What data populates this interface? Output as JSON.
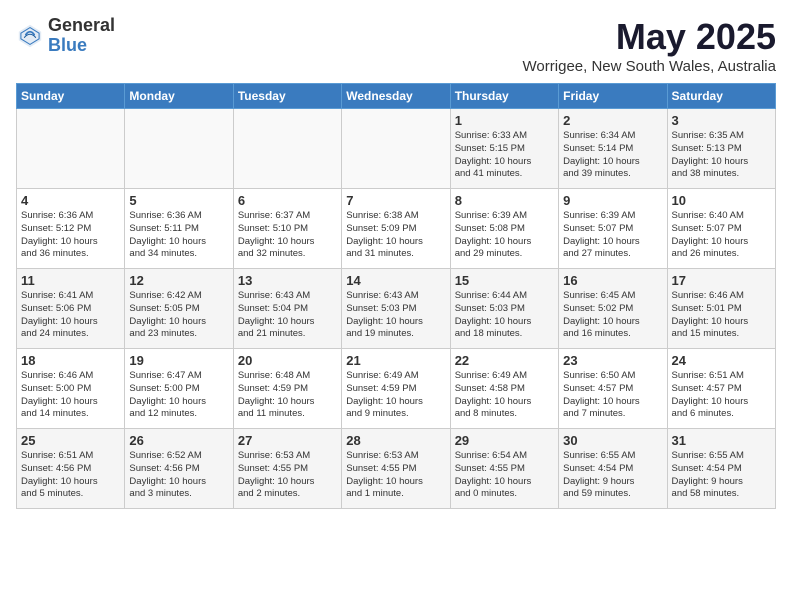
{
  "logo": {
    "general": "General",
    "blue": "Blue"
  },
  "header": {
    "month": "May 2025",
    "location": "Worrigee, New South Wales, Australia"
  },
  "weekdays": [
    "Sunday",
    "Monday",
    "Tuesday",
    "Wednesday",
    "Thursday",
    "Friday",
    "Saturday"
  ],
  "weeks": [
    [
      {
        "day": "",
        "content": ""
      },
      {
        "day": "",
        "content": ""
      },
      {
        "day": "",
        "content": ""
      },
      {
        "day": "",
        "content": ""
      },
      {
        "day": "1",
        "content": "Sunrise: 6:33 AM\nSunset: 5:15 PM\nDaylight: 10 hours\nand 41 minutes."
      },
      {
        "day": "2",
        "content": "Sunrise: 6:34 AM\nSunset: 5:14 PM\nDaylight: 10 hours\nand 39 minutes."
      },
      {
        "day": "3",
        "content": "Sunrise: 6:35 AM\nSunset: 5:13 PM\nDaylight: 10 hours\nand 38 minutes."
      }
    ],
    [
      {
        "day": "4",
        "content": "Sunrise: 6:36 AM\nSunset: 5:12 PM\nDaylight: 10 hours\nand 36 minutes."
      },
      {
        "day": "5",
        "content": "Sunrise: 6:36 AM\nSunset: 5:11 PM\nDaylight: 10 hours\nand 34 minutes."
      },
      {
        "day": "6",
        "content": "Sunrise: 6:37 AM\nSunset: 5:10 PM\nDaylight: 10 hours\nand 32 minutes."
      },
      {
        "day": "7",
        "content": "Sunrise: 6:38 AM\nSunset: 5:09 PM\nDaylight: 10 hours\nand 31 minutes."
      },
      {
        "day": "8",
        "content": "Sunrise: 6:39 AM\nSunset: 5:08 PM\nDaylight: 10 hours\nand 29 minutes."
      },
      {
        "day": "9",
        "content": "Sunrise: 6:39 AM\nSunset: 5:07 PM\nDaylight: 10 hours\nand 27 minutes."
      },
      {
        "day": "10",
        "content": "Sunrise: 6:40 AM\nSunset: 5:07 PM\nDaylight: 10 hours\nand 26 minutes."
      }
    ],
    [
      {
        "day": "11",
        "content": "Sunrise: 6:41 AM\nSunset: 5:06 PM\nDaylight: 10 hours\nand 24 minutes."
      },
      {
        "day": "12",
        "content": "Sunrise: 6:42 AM\nSunset: 5:05 PM\nDaylight: 10 hours\nand 23 minutes."
      },
      {
        "day": "13",
        "content": "Sunrise: 6:43 AM\nSunset: 5:04 PM\nDaylight: 10 hours\nand 21 minutes."
      },
      {
        "day": "14",
        "content": "Sunrise: 6:43 AM\nSunset: 5:03 PM\nDaylight: 10 hours\nand 19 minutes."
      },
      {
        "day": "15",
        "content": "Sunrise: 6:44 AM\nSunset: 5:03 PM\nDaylight: 10 hours\nand 18 minutes."
      },
      {
        "day": "16",
        "content": "Sunrise: 6:45 AM\nSunset: 5:02 PM\nDaylight: 10 hours\nand 16 minutes."
      },
      {
        "day": "17",
        "content": "Sunrise: 6:46 AM\nSunset: 5:01 PM\nDaylight: 10 hours\nand 15 minutes."
      }
    ],
    [
      {
        "day": "18",
        "content": "Sunrise: 6:46 AM\nSunset: 5:00 PM\nDaylight: 10 hours\nand 14 minutes."
      },
      {
        "day": "19",
        "content": "Sunrise: 6:47 AM\nSunset: 5:00 PM\nDaylight: 10 hours\nand 12 minutes."
      },
      {
        "day": "20",
        "content": "Sunrise: 6:48 AM\nSunset: 4:59 PM\nDaylight: 10 hours\nand 11 minutes."
      },
      {
        "day": "21",
        "content": "Sunrise: 6:49 AM\nSunset: 4:59 PM\nDaylight: 10 hours\nand 9 minutes."
      },
      {
        "day": "22",
        "content": "Sunrise: 6:49 AM\nSunset: 4:58 PM\nDaylight: 10 hours\nand 8 minutes."
      },
      {
        "day": "23",
        "content": "Sunrise: 6:50 AM\nSunset: 4:57 PM\nDaylight: 10 hours\nand 7 minutes."
      },
      {
        "day": "24",
        "content": "Sunrise: 6:51 AM\nSunset: 4:57 PM\nDaylight: 10 hours\nand 6 minutes."
      }
    ],
    [
      {
        "day": "25",
        "content": "Sunrise: 6:51 AM\nSunset: 4:56 PM\nDaylight: 10 hours\nand 5 minutes."
      },
      {
        "day": "26",
        "content": "Sunrise: 6:52 AM\nSunset: 4:56 PM\nDaylight: 10 hours\nand 3 minutes."
      },
      {
        "day": "27",
        "content": "Sunrise: 6:53 AM\nSunset: 4:55 PM\nDaylight: 10 hours\nand 2 minutes."
      },
      {
        "day": "28",
        "content": "Sunrise: 6:53 AM\nSunset: 4:55 PM\nDaylight: 10 hours\nand 1 minute."
      },
      {
        "day": "29",
        "content": "Sunrise: 6:54 AM\nSunset: 4:55 PM\nDaylight: 10 hours\nand 0 minutes."
      },
      {
        "day": "30",
        "content": "Sunrise: 6:55 AM\nSunset: 4:54 PM\nDaylight: 9 hours\nand 59 minutes."
      },
      {
        "day": "31",
        "content": "Sunrise: 6:55 AM\nSunset: 4:54 PM\nDaylight: 9 hours\nand 58 minutes."
      }
    ]
  ]
}
